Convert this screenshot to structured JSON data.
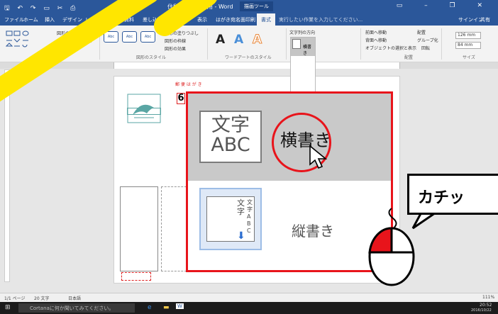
{
  "titlebar": {
    "quick_access": "🖫 ↶ ↷ ▭ ✂ ⎙",
    "window_title": "住所はがき住所用 - Word",
    "context_tab": "描画ツール",
    "window_buttons": "▭ – ❐ ✕"
  },
  "tabs": [
    "ファイル",
    "ホーム",
    "挿入",
    "デザイン",
    "レイアウト",
    "参考資料",
    "差し込み文書",
    "校閲",
    "表示",
    "はがき宛名面印刷",
    "書式"
  ],
  "tell_me": "実行したい作業を入力してください...",
  "account": {
    "sign_in": "サインイン",
    "share": "共有"
  },
  "ribbon": {
    "insert_shapes": {
      "label": "図形の挿入",
      "edit_shape": "図形の編集",
      "text_box": "テキスト ボックス"
    },
    "shape_styles": {
      "label": "図形のスタイル",
      "style_text": "Abc",
      "fill": "図形の塗りつぶし",
      "outline": "図形の枠線",
      "effects": "図形の効果"
    },
    "wordart_styles": {
      "label": "ワードアートのスタイル",
      "sample": "A"
    },
    "text": {
      "direction": "文字列の方向",
      "popup_item": "横書き"
    },
    "arrange": {
      "label": "配置",
      "front": "前面へ移動",
      "back": "背面へ移動",
      "selection": "オブジェクトの選択と表示",
      "align": "配置",
      "group": "グループ化",
      "rotate": "回転"
    },
    "size": {
      "label": "サイズ",
      "height": "126 mm",
      "width": "84 mm"
    }
  },
  "document": {
    "header_text": "郵 便 は が き",
    "postal_digit": "6"
  },
  "zoom": {
    "horizontal_icon": "文字\nABC",
    "horizontal_label": "横書き",
    "vertical_icon_a": "文字",
    "vertical_icon_b": "文字ABC",
    "vertical_label": "縦書き"
  },
  "callout": "カチッ",
  "statusbar": {
    "page": "1/1 ページ",
    "words": "20 文字",
    "lang": "日本語",
    "zoom": "111%"
  },
  "taskbar": {
    "search": "Cortanaに何か聞いてみてください。",
    "time": "20:52",
    "date": "2016/10/22"
  },
  "colors": {
    "highlight_red": "#e8141b",
    "stroke_yellow": "#ffe600",
    "word_blue": "#2b579a"
  }
}
